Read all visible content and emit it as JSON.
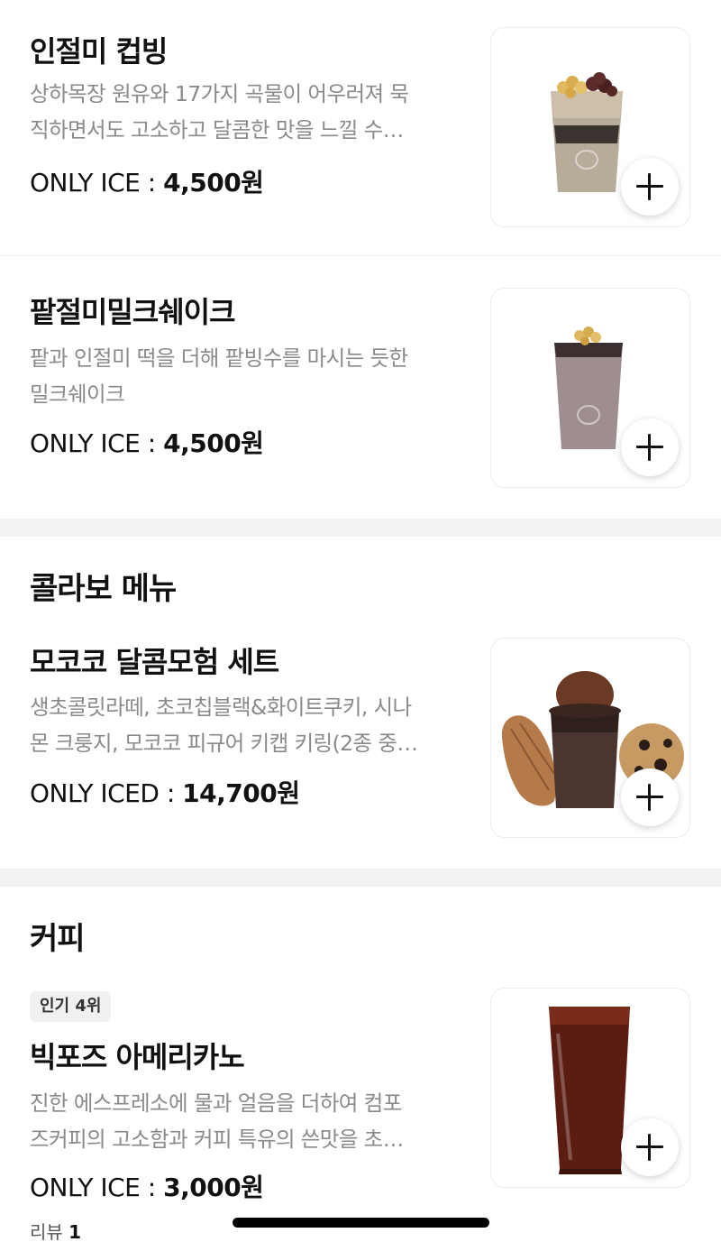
{
  "items": [
    {
      "title": "인절미 컵빙",
      "desc_lines": [
        "상하목장 원유와 17가지 곡물이 어우러져 묵",
        "직하면서도 고소하고 달콤한 맛을 느낄 수…"
      ],
      "price_label": "ONLY ICE : ",
      "price": "4,500원"
    },
    {
      "title": "팥절미밀크쉐이크",
      "desc_lines": [
        "팥과 인절미 떡을 더해 팥빙수를 마시는 듯한",
        "밀크쉐이크"
      ],
      "price_label": "ONLY ICE : ",
      "price": "4,500원"
    },
    {
      "title": "모코코 달콤모험 세트",
      "desc_lines": [
        "생초콜릿라떼, 초코칩블랙&화이트쿠키, 시나",
        "몬 크룽지, 모코코 피규어 키캡 키링(2종 중…"
      ],
      "price_label": "ONLY ICED : ",
      "price": "14,700원"
    },
    {
      "title": "빅포즈 아메리카노",
      "desc_lines": [
        "진한 에스프레소에 물과 얼음을 더하여 컴포",
        "즈커피의 고소함과 커피 특유의 쓴맛을 초…"
      ],
      "price_label": "ONLY ICE : ",
      "price": "3,000원",
      "badge": "인기 4위",
      "review_label": "리뷰 ",
      "review_count": "1"
    }
  ],
  "sections": {
    "collab": "콜라보 메뉴",
    "coffee": "커피"
  },
  "icons": {
    "add": "plus-icon"
  },
  "colors": {
    "text": "#111111",
    "desc": "#8a8a8a",
    "divider": "#f2f2f2"
  }
}
